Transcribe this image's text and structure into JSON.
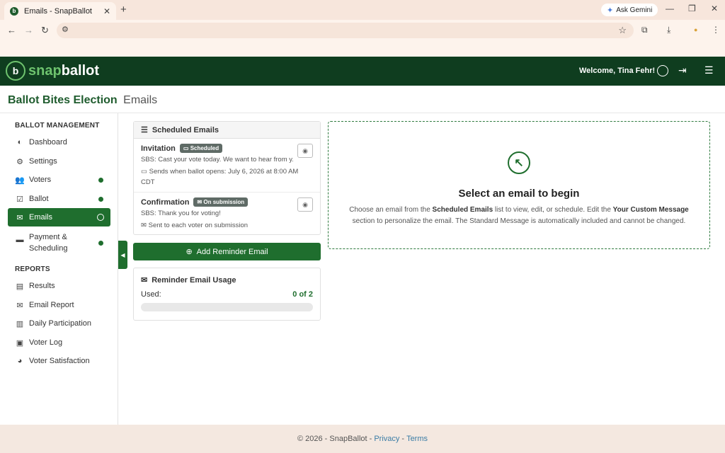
{
  "browser": {
    "tab_title": "Emails - SnapBallot",
    "tab_close": "✕",
    "new_tab": "+",
    "gemini_label": "Ask Gemini",
    "gemini_icon": "✦",
    "minimize": "—",
    "restore": "❐",
    "close": "✕",
    "back": "←",
    "forward": "→",
    "reload": "↻",
    "site_info": "⚙",
    "bookmark": "☆",
    "extensions": "⧉",
    "download": "⤓",
    "profile": "●",
    "menu": "⋮"
  },
  "header": {
    "logo_badge": "b",
    "logo_snap": "snap",
    "logo_ballot": "ballot",
    "welcome": "Welcome, Tina Fehr!",
    "logout_icon": "⇥",
    "menu_icon": "☰"
  },
  "page": {
    "election_name": "Ballot Bites Election",
    "section": "Emails"
  },
  "sidebar": {
    "management_heading": "BALLOT MANAGEMENT",
    "reports_heading": "REPORTS",
    "items": [
      {
        "label": "Dashboard",
        "icon": "◐"
      },
      {
        "label": "Settings",
        "icon": "⚙"
      },
      {
        "label": "Voters",
        "icon": "👥"
      },
      {
        "label": "Ballot",
        "icon": "☑"
      },
      {
        "label": "Emails",
        "icon": "✉"
      },
      {
        "label": "Payment &",
        "label2": "Scheduling",
        "icon": "▬"
      }
    ],
    "reports": [
      {
        "label": "Results",
        "icon": "▤"
      },
      {
        "label": "Email Report",
        "icon": "✉"
      },
      {
        "label": "Daily Participation",
        "icon": "▥"
      },
      {
        "label": "Voter Log",
        "icon": "▣"
      },
      {
        "label": "Voter Satisfaction",
        "icon": "◕"
      }
    ],
    "collapse_icon": "◀"
  },
  "scheduled": {
    "title": "Scheduled Emails",
    "list_icon": "☰",
    "emails": [
      {
        "name": "Invitation",
        "badge": "Scheduled",
        "badge_icon": "▭",
        "subject": "SBS: Cast your vote today. We want to hear from y...",
        "send_icon": "▭",
        "send_info": "Sends when ballot opens: July 6, 2026 at 8:00 AM CDT"
      },
      {
        "name": "Confirmation",
        "badge": "On submission",
        "badge_icon": "✉",
        "subject": "SBS: Thank you for voting!",
        "send_icon": "✉",
        "send_info": "Sent to each voter on submission"
      }
    ],
    "eye_icon": "◉"
  },
  "add_reminder": {
    "label": "Add Reminder Email",
    "icon": "⊕"
  },
  "usage": {
    "title": "Reminder Email Usage",
    "icon": "✉",
    "used_label": "Used:",
    "used_value": "0 of 2",
    "used_fraction": 0
  },
  "placeholder": {
    "icon": "↖",
    "title": "Select an email to begin",
    "desc_1": "Choose an email from the ",
    "desc_b1": "Scheduled Emails",
    "desc_2": " list to view, edit, or schedule. Edit the ",
    "desc_b2": "Your Custom Message",
    "desc_3": " section to personalize the email. The Standard Message is automatically included and cannot be changed."
  },
  "footer": {
    "copyright": "© 2026 - SnapBallot -",
    "privacy": "Privacy",
    "sep": "-",
    "terms": "Terms"
  },
  "colors": {
    "brand_dark": "#0f3d1f",
    "brand": "#1f6e2e",
    "brand_light": "#6ec36e"
  }
}
